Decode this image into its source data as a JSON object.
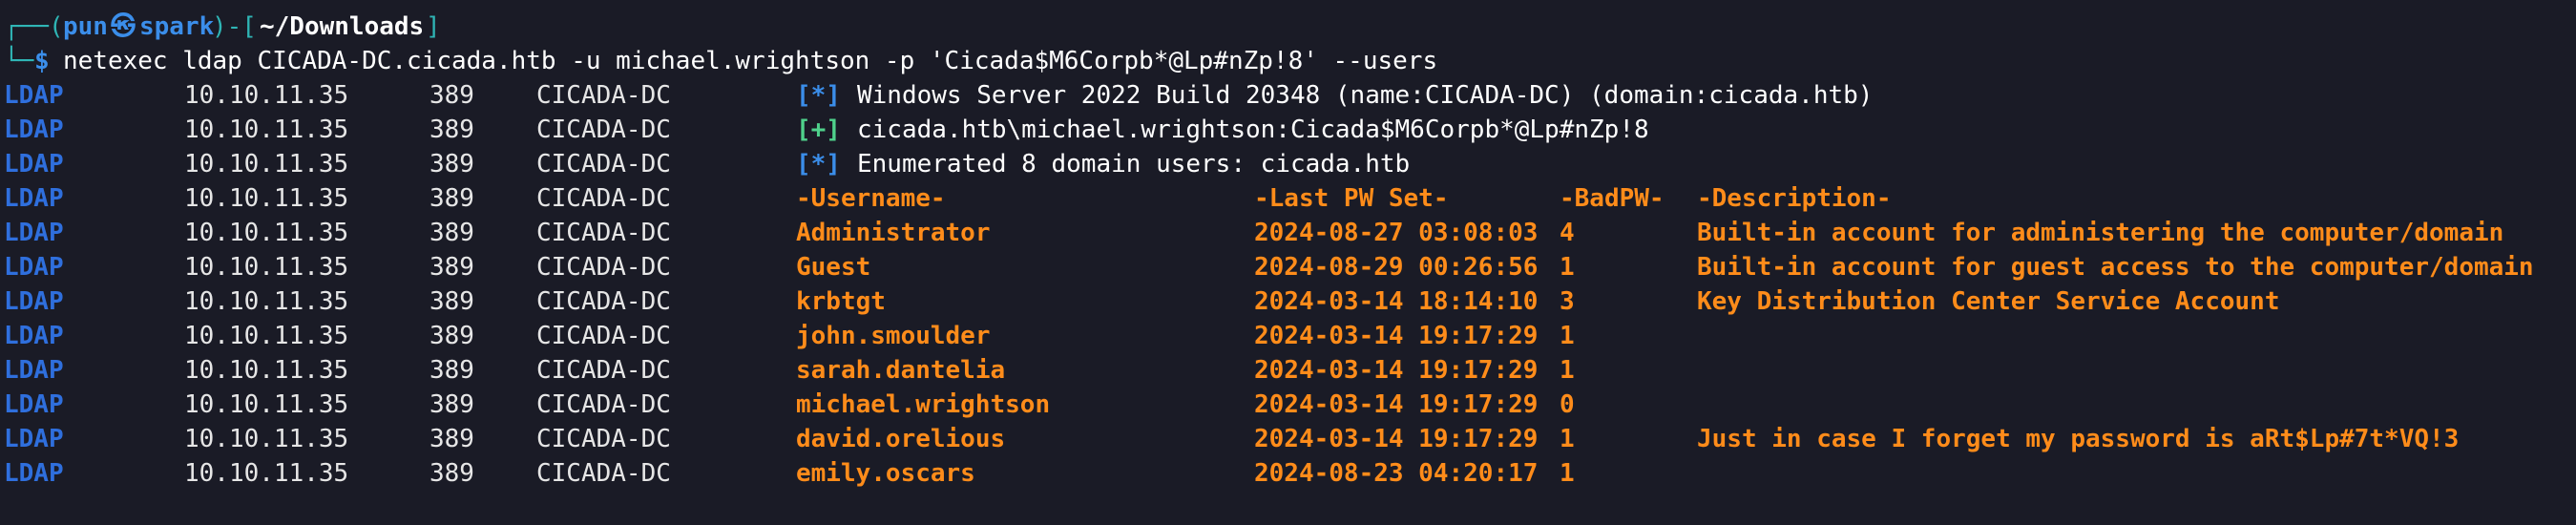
{
  "prompt": {
    "corner_top": "┌──(",
    "user": "pun",
    "at_icon": "㉿",
    "host": "spark",
    "mid": ")-[",
    "path": "~/Downloads",
    "close": "]",
    "corner_bottom": "└─",
    "dollar": "$",
    "command": "netexec ldap CICADA-DC.cicada.htb -u michael.wrightson -p 'Cicada$M6Corpb*@Lp#nZp!8' --users"
  },
  "rows": [
    {
      "proto": "LDAP",
      "ip": "10.10.11.35",
      "port": "389",
      "host": "CICADA-DC",
      "marker": "[*]",
      "marker_type": "info",
      "text": "Windows Server 2022 Build 20348 (name:CICADA-DC) (domain:cicada.htb)"
    },
    {
      "proto": "LDAP",
      "ip": "10.10.11.35",
      "port": "389",
      "host": "CICADA-DC",
      "marker": "[+]",
      "marker_type": "success",
      "text": "cicada.htb\\michael.wrightson:Cicada$M6Corpb*@Lp#nZp!8"
    },
    {
      "proto": "LDAP",
      "ip": "10.10.11.35",
      "port": "389",
      "host": "CICADA-DC",
      "marker": "[*]",
      "marker_type": "info",
      "text": "Enumerated 8 domain users: cicada.htb"
    }
  ],
  "table_header": {
    "username": "-Username-",
    "last_pw_set": "-Last PW Set-",
    "badpw": "-BadPW-",
    "description": "-Description-"
  },
  "users": [
    {
      "proto": "LDAP",
      "ip": "10.10.11.35",
      "port": "389",
      "host": "CICADA-DC",
      "username": "Administrator",
      "last_pw_set": "2024-08-27 03:08:03",
      "badpw": "4",
      "description": "Built-in account for administering the computer/domain"
    },
    {
      "proto": "LDAP",
      "ip": "10.10.11.35",
      "port": "389",
      "host": "CICADA-DC",
      "username": "Guest",
      "last_pw_set": "2024-08-29 00:26:56",
      "badpw": "1",
      "description": "Built-in account for guest access to the computer/domain"
    },
    {
      "proto": "LDAP",
      "ip": "10.10.11.35",
      "port": "389",
      "host": "CICADA-DC",
      "username": "krbtgt",
      "last_pw_set": "2024-03-14 18:14:10",
      "badpw": "3",
      "description": "Key Distribution Center Service Account"
    },
    {
      "proto": "LDAP",
      "ip": "10.10.11.35",
      "port": "389",
      "host": "CICADA-DC",
      "username": "john.smoulder",
      "last_pw_set": "2024-03-14 19:17:29",
      "badpw": "1",
      "description": ""
    },
    {
      "proto": "LDAP",
      "ip": "10.10.11.35",
      "port": "389",
      "host": "CICADA-DC",
      "username": "sarah.dantelia",
      "last_pw_set": "2024-03-14 19:17:29",
      "badpw": "1",
      "description": ""
    },
    {
      "proto": "LDAP",
      "ip": "10.10.11.35",
      "port": "389",
      "host": "CICADA-DC",
      "username": "michael.wrightson",
      "last_pw_set": "2024-03-14 19:17:29",
      "badpw": "0",
      "description": ""
    },
    {
      "proto": "LDAP",
      "ip": "10.10.11.35",
      "port": "389",
      "host": "CICADA-DC",
      "username": "david.orelious",
      "last_pw_set": "2024-03-14 19:17:29",
      "badpw": "1",
      "description": "Just in case I forget my password is aRt$Lp#7t*VQ!3"
    },
    {
      "proto": "LDAP",
      "ip": "10.10.11.35",
      "port": "389",
      "host": "CICADA-DC",
      "username": "emily.oscars",
      "last_pw_set": "2024-08-23 04:20:17",
      "badpw": "1",
      "description": ""
    }
  ],
  "colors": {
    "background": "#1a1b26",
    "prompt_teal": "#2fb5b5",
    "accent_blue": "#3b8eea",
    "ldap_blue": "#2f6fdd",
    "success_green": "#4fd18b",
    "highlight_orange": "#ff8c1a"
  }
}
